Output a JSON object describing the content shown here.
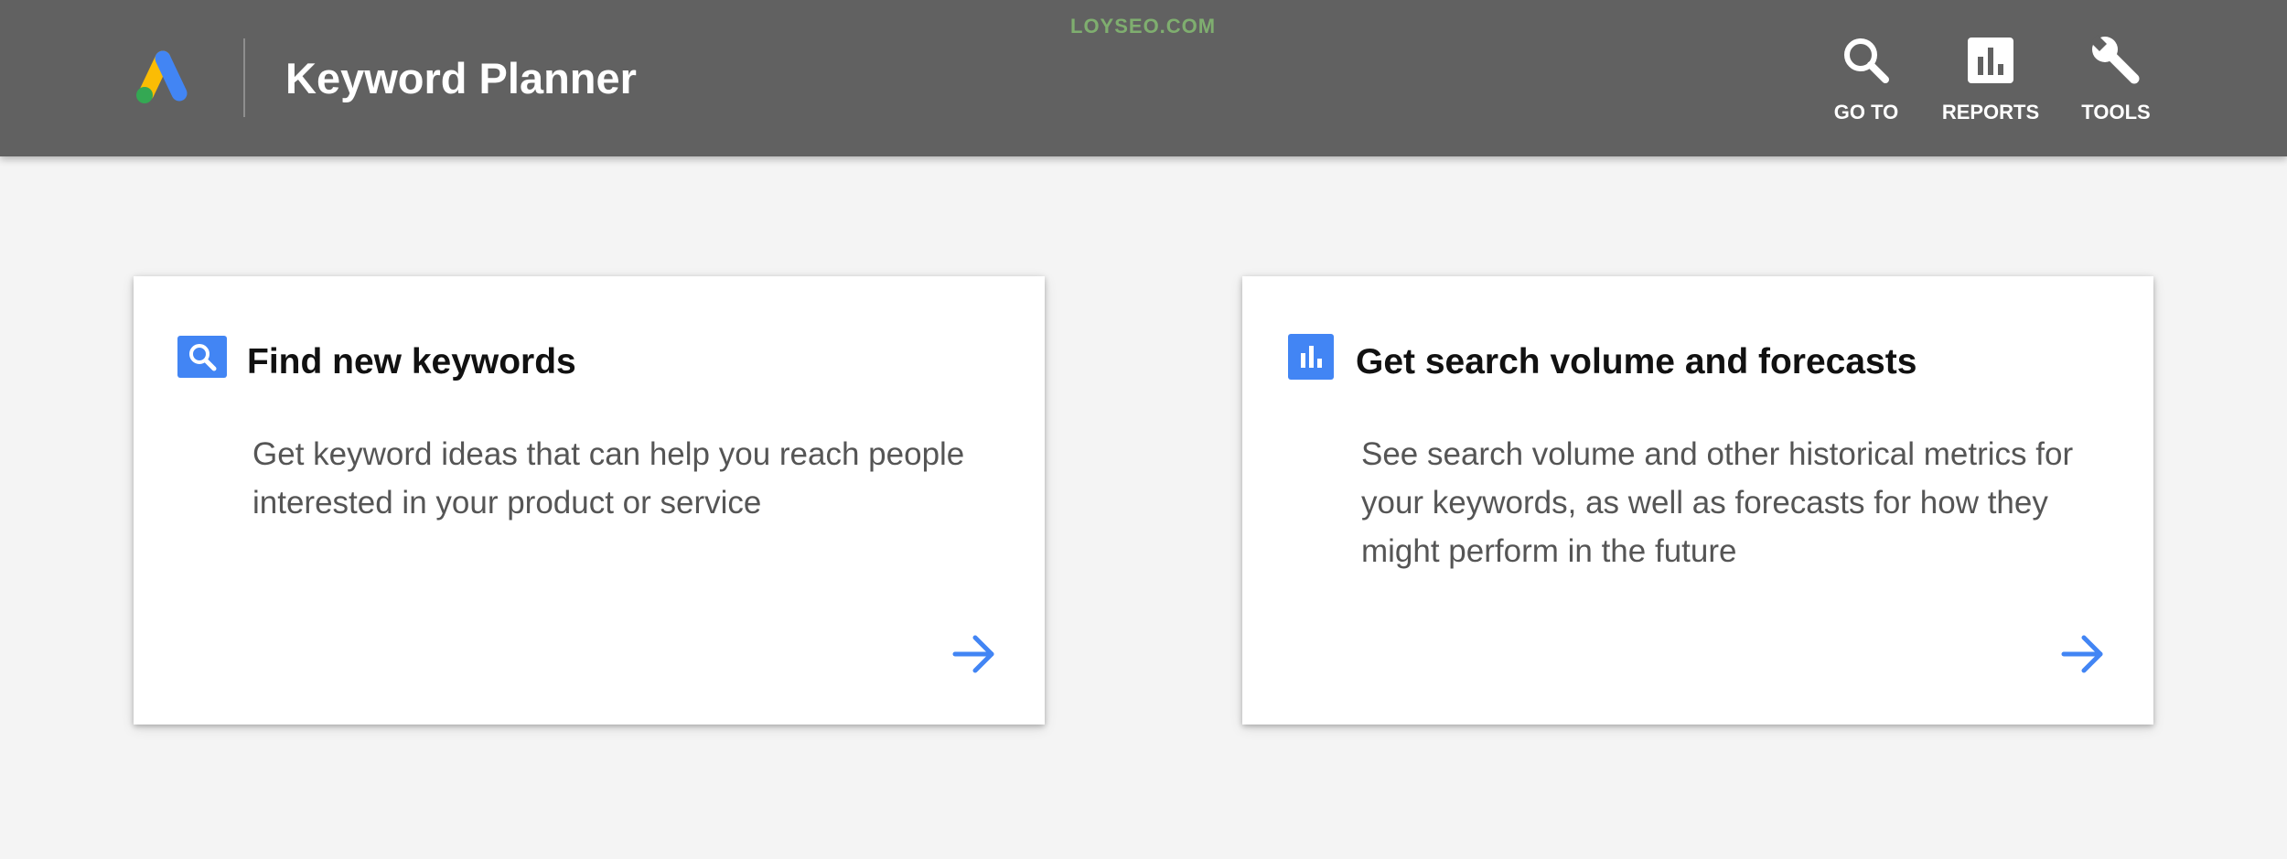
{
  "watermark": "LOYSEO.COM",
  "header": {
    "title": "Keyword Planner",
    "logo_icon": "google-ads-logo-icon",
    "nav": [
      {
        "label": "GO TO",
        "icon": "search-icon"
      },
      {
        "label": "REPORTS",
        "icon": "bar-chart-icon"
      },
      {
        "label": "TOOLS",
        "icon": "wrench-icon"
      }
    ]
  },
  "cards": [
    {
      "title": "Find new keywords",
      "description": "Get keyword ideas that can help you reach people interested in your product or service",
      "icon": "search-icon",
      "arrow_icon": "arrow-right-icon"
    },
    {
      "title": "Get search volume and forecasts",
      "description": "See search volume and other historical metrics for your keywords, as well as forecasts for how they might perform in the future",
      "icon": "bar-chart-icon",
      "arrow_icon": "arrow-right-icon"
    }
  ],
  "colors": {
    "header_bg": "#616161",
    "page_bg": "#f4f4f4",
    "accent_blue": "#4285f4",
    "logo_yellow": "#fbbc04",
    "logo_blue": "#4285f4",
    "logo_green": "#34a853"
  }
}
